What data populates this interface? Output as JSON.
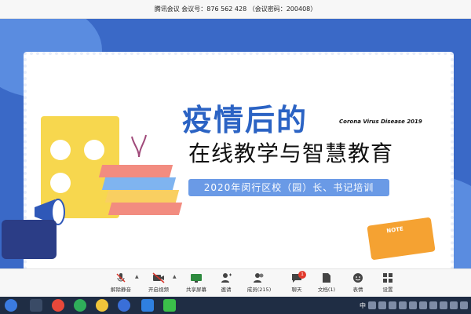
{
  "window": {
    "title": "腾讯会议 会议号：876 562 428 （会议密码：200408）"
  },
  "slide": {
    "headline1": "疫情后的",
    "subtitle_en": "Corona Virus Disease 2019",
    "headline2": "在线教学与智慧教育",
    "training": "2020年闵行区校（园）长、书记培训",
    "notebook_label": "NOTE"
  },
  "toolbar": {
    "mute": "解除静音",
    "video": "开启视频",
    "share": "共享屏幕",
    "invite": "邀请",
    "members": "成员(215)",
    "chat": "聊天",
    "chat_badge": "1",
    "docs": "文档(1)",
    "reactions": "表情",
    "settings": "设置"
  },
  "taskbar": {
    "ime": "中"
  }
}
